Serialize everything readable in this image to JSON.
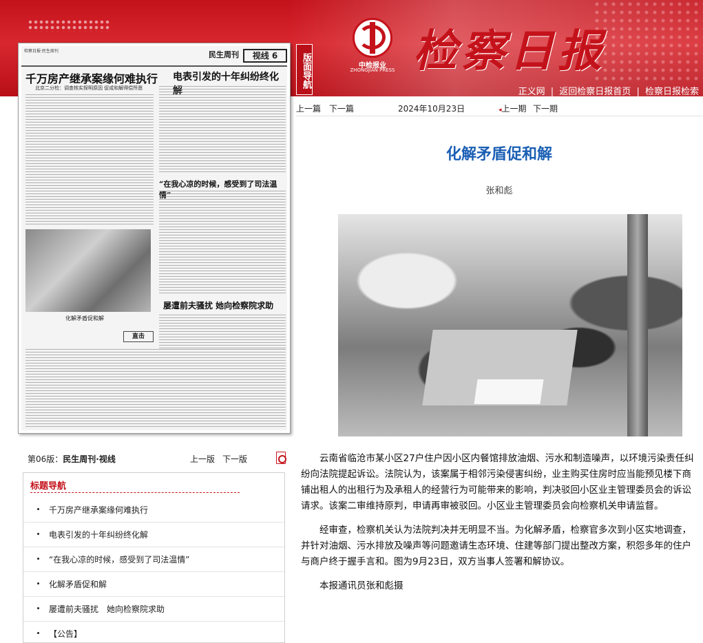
{
  "banner": {
    "nav_tab": "版面导航",
    "logo_cn": "中检报业",
    "logo_en": "ZHONGJIAN PRESS",
    "masthead": "检察日报",
    "links": [
      "正义网",
      "返回检察日报首页",
      "检察日报检索"
    ]
  },
  "thumbnail": {
    "masthead_small": "检察日报·民生周刊",
    "section": "民生周刊",
    "section_box": "视线 6",
    "headline_1": "千万房产继承案缘何难执行",
    "headline_1_sub": "北京二分检：调查核实探明原因 促成和解得偿所愿",
    "headline_2": "电表引发的十年纠纷终化解",
    "headline_3": "“在我心凉的时候，感受到了司法温情”",
    "headline_4": "屡遭前夫骚扰 她向检察院求助",
    "caption": "化解矛盾促和解",
    "stamp": "直击"
  },
  "edition": {
    "name_prefix": "第06版：",
    "name": "民生周刊·视线",
    "prev": "上一版",
    "next": "下一版"
  },
  "topics": {
    "title": "标题导航",
    "items": [
      "千万房产继承案缘何难执行",
      "电表引发的十年纠纷终化解",
      "“在我心凉的时候，感受到了司法温情”",
      "化解矛盾促和解",
      "屡遭前夫骚扰　她向检察院求助",
      "【公告】"
    ]
  },
  "nav": {
    "prev_article": "上一篇",
    "next_article": "下一篇",
    "date": "2024年10月23日",
    "prev_period": "上一期",
    "next_period": "下一期"
  },
  "article": {
    "title": "化解矛盾促和解",
    "author": "张和彪",
    "paragraphs": [
      "云南省临沧市某小区27户住户因小区内餐馆排放油烟、污水和制造噪声，以环境污染责任纠纷向法院提起诉讼。法院认为，该案属于相邻污染侵害纠纷，业主购买住房时应当能预见楼下商铺出租人的出租行为及承租人的经营行为可能带来的影响，判决驳回小区业主管理委员会的诉讼请求。该案二审维持原判，申请再审被驳回。小区业主管理委员会向检察机关申请监督。",
      "经审查，检察机关认为法院判决并无明显不当。为化解矛盾，检察官多次到小区实地调查，并针对油烟、污水排放及噪声等问题邀请生态环境、住建等部门提出整改方案，积怨多年的住户与商户终于握手言和。图为9月23日，双方当事人签署和解协议。",
      "本报通讯员张和彪摄"
    ]
  },
  "colors": {
    "brand_red": "#c4121b",
    "title_blue": "#1a5fb4"
  }
}
